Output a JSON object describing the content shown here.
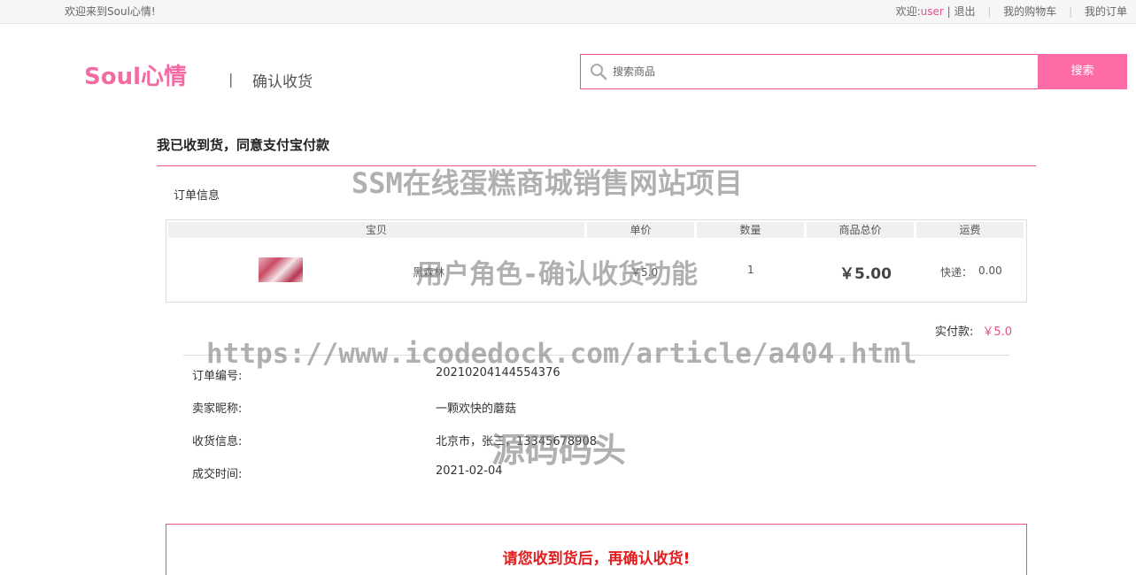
{
  "topbar": {
    "welcome": "欢迎来到Soul心情!",
    "greet": "欢迎:",
    "username": "user",
    "pipe": "|",
    "logout": "退出",
    "cart": "我的购物车",
    "orders": "我的订单"
  },
  "header": {
    "logo": "Soul心情",
    "separator": "|",
    "page_name": "确认收货"
  },
  "search": {
    "placeholder": "搜索商品",
    "button": "搜索"
  },
  "main": {
    "title": "我已收到货，同意支付宝付款",
    "order_info_label": "订单信息"
  },
  "table": {
    "headers": [
      "宝贝",
      "单价",
      "数量",
      "商品总价",
      "运费"
    ],
    "row": {
      "product_name": "黑森林",
      "unit_price": "￥5.0",
      "quantity": "1",
      "total": "￥5.00",
      "shipping_label": "快递：",
      "shipping_fee": "0.00"
    }
  },
  "paid": {
    "label": "实付款:",
    "amount": "￥5.0"
  },
  "details": [
    {
      "label": "订单编号:",
      "value": "20210204144554376"
    },
    {
      "label": "卖家昵称:",
      "value": "一颗欢快的蘑菇"
    },
    {
      "label": "收货信息:",
      "value": "北京市，张三，13345678908"
    },
    {
      "label": "成交时间:",
      "value": "2021-02-04"
    }
  ],
  "notice": "请您收到货后，再确认收货!",
  "watermarks": [
    "SSM在线蛋糕商城销售网站项目",
    "用户角色-确认收货功能",
    "https://www.icodedock.com/article/a404.html",
    "源码码头"
  ],
  "colors": {
    "brand_pink": "#f36ba5",
    "search_button": "#ff6ba6",
    "accent_border": "#e4508e",
    "notice_red": "#e31d1d"
  }
}
